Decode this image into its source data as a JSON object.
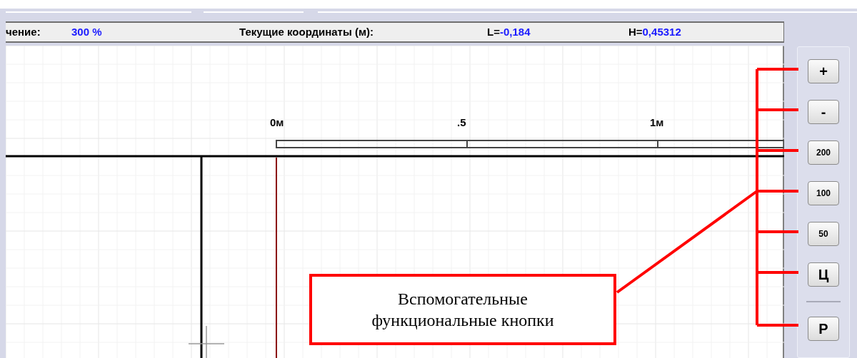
{
  "status_bar": {
    "zoom_label": "чение:",
    "zoom_value": "300 %",
    "coords_label": "Текущие координаты (м):",
    "l_label": "L=",
    "l_value": "-0,184",
    "h_label": "H=",
    "h_value": "0,45312"
  },
  "canvas": {
    "ruler_labels": [
      "0м",
      ".5",
      "1м"
    ]
  },
  "side_buttons": [
    {
      "label": "+",
      "kind": "large"
    },
    {
      "label": "-",
      "kind": "large"
    },
    {
      "label": "200",
      "kind": "small"
    },
    {
      "label": "100",
      "kind": "small"
    },
    {
      "label": "50",
      "kind": "small"
    },
    {
      "label": "Ц",
      "kind": "large"
    }
  ],
  "extra_buttons": [
    {
      "label": "Р",
      "kind": "large"
    }
  ],
  "callout": {
    "text": "Вспомогательные\nфункциональные кнопки"
  }
}
